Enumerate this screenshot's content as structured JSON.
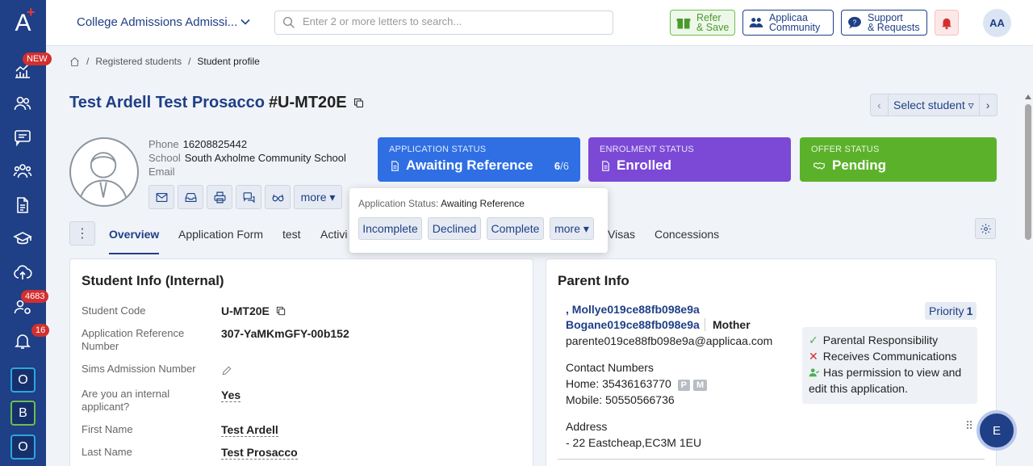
{
  "sidebar": {
    "new_badge": "NEW",
    "students_badge": "4683",
    "notifications_badge": "16",
    "apps": [
      {
        "label": "O",
        "color": "#2aa7e0"
      },
      {
        "label": "B",
        "color": "#6bbf4e"
      },
      {
        "label": "O",
        "color": "#2aa7e0"
      }
    ]
  },
  "topbar": {
    "org_name": "College Admissions Admissi...",
    "search_placeholder": "Enter 2 or more letters to search...",
    "refer_line1": "Refer",
    "refer_line2": "& Save",
    "community_line1": "Applicaa",
    "community_line2": "Community",
    "support_line1": "Support",
    "support_line2": "& Requests",
    "avatar": "AA"
  },
  "breadcrumb": {
    "item1": "Registered students",
    "sep": "/",
    "current": "Student profile"
  },
  "student": {
    "name": "Test Ardell Test Prosacco",
    "code": "#U-MT20E",
    "phone_label": "Phone",
    "phone": "16208825442",
    "school_label": "School",
    "school": "South Axholme Community School",
    "email_label": "Email",
    "more": "more ▾"
  },
  "select_student": {
    "label": "Select student ▿",
    "prev": "‹",
    "next": "›"
  },
  "statuses": {
    "application": {
      "caption": "APPLICATION STATUS",
      "value": "Awaiting Reference",
      "count": "6",
      "total": "/6"
    },
    "enrolment": {
      "caption": "ENROLMENT STATUS",
      "value": "Enrolled"
    },
    "offer": {
      "caption": "OFFER STATUS",
      "value": "Pending"
    }
  },
  "popup": {
    "label": "Application Status:",
    "value": "Awaiting Reference",
    "buttons": [
      "Incomplete",
      "Declined",
      "Complete",
      "more ▾"
    ]
  },
  "tabs": {
    "dots": "⋮",
    "items": [
      "Overview",
      "Application Form",
      "test",
      "Activi",
      "Visas",
      "Concessions"
    ]
  },
  "student_info": {
    "title": "Student Info (Internal)",
    "rows": [
      {
        "label": "Student Code",
        "value": "U-MT20E"
      },
      {
        "label": "Application Reference Number",
        "value": "307-YaMKmGFY-00b152"
      },
      {
        "label": "Sims Admission Number",
        "value": ""
      },
      {
        "label": "Are you an internal applicant?",
        "value": "Yes"
      },
      {
        "label": "First Name",
        "value": "Test Ardell"
      },
      {
        "label": "Last Name",
        "value": "Test Prosacco"
      }
    ]
  },
  "parent_info": {
    "title": "Parent Info",
    "priority_label": "Priority",
    "priority_value": "1",
    "name_line1": ", Mollye019ce88fb098e9a",
    "name_line2": "Bogane019ce88fb098e9a",
    "relation": "Mother",
    "email": "parente019ce88fb098e9a@applicaa.com",
    "contact_title": "Contact Numbers",
    "home": "Home: 35436163770",
    "mobile": "Mobile: 50550566736",
    "home_tags": [
      "P",
      "M"
    ],
    "address_title": "Address",
    "address": "- 22 Eastcheap,EC3M 1EU",
    "permissions": {
      "parental": "Parental Responsibility",
      "comms": "Receives Communications",
      "view_edit": "Has permission to view and edit this application."
    }
  },
  "chat": {
    "label": "E"
  }
}
